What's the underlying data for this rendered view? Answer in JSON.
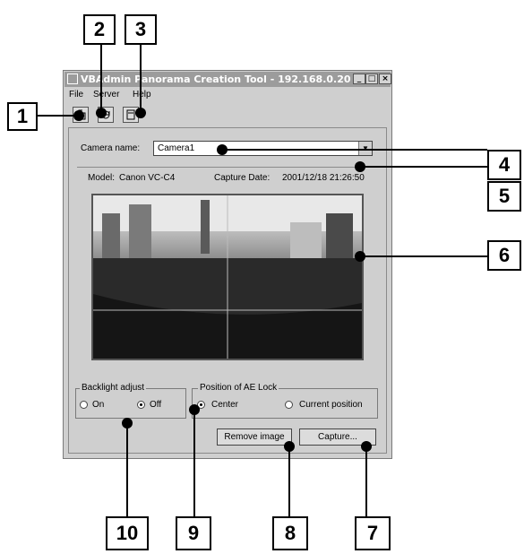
{
  "callouts": {
    "c1": "1",
    "c2": "2",
    "c3": "3",
    "c4": "4",
    "c5": "5",
    "c6": "6",
    "c7": "7",
    "c8": "8",
    "c9": "9",
    "c10": "10"
  },
  "window": {
    "title": "VBAdmin Panorama Creation Tool - 192.168.0.20",
    "minimize": "_",
    "maximize": "□",
    "close": "×"
  },
  "menu": {
    "file": "File",
    "server": "Server",
    "help": "Help"
  },
  "camera": {
    "name_label": "Camera name:",
    "name_value": "Camera1",
    "model_label": "Model:",
    "model_value": "Canon VC-C4",
    "capture_date_label": "Capture Date:",
    "capture_date_value": "2001/12/18  21:26:50"
  },
  "backlight": {
    "title": "Backlight adjust",
    "on": "On",
    "off": "Off",
    "selected": "Off"
  },
  "ae_lock": {
    "title": "Position of AE Lock",
    "center": "Center",
    "current": "Current position",
    "selected": "Center"
  },
  "buttons": {
    "remove": "Remove image",
    "capture": "Capture..."
  },
  "icons": {
    "toolbar": [
      "open-icon",
      "refresh-icon",
      "save-icon"
    ]
  }
}
